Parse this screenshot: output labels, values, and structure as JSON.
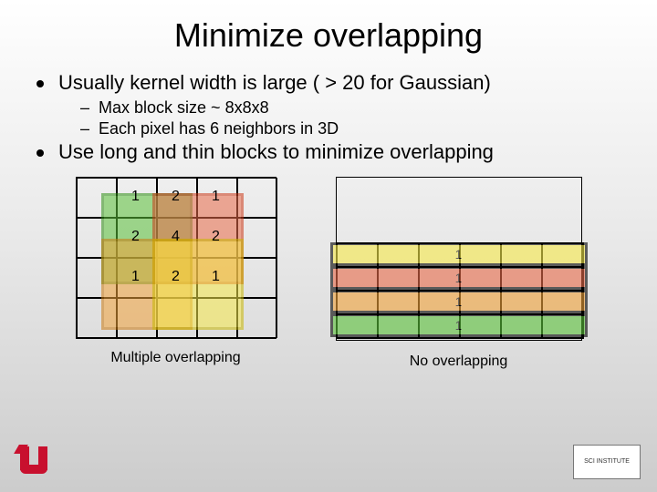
{
  "title": "Minimize overlapping",
  "bullets": [
    {
      "text": "Usually kernel width is large ( > 20 for Gaussian)"
    },
    {
      "text": "Use long and thin blocks to minimize overlapping"
    }
  ],
  "subbullets": [
    {
      "text": "Max block size ~ 8x8x8"
    },
    {
      "text": "Each pixel has 6 neighbors in 3D"
    }
  ],
  "left": {
    "caption": "Multiple overlapping",
    "values": {
      "r0c0": "1",
      "r0c1": "2",
      "r0c2": "1",
      "r1c0": "2",
      "r1c1": "4",
      "r1c2": "2",
      "r2c0": "1",
      "r2c1": "2",
      "r2c2": "1"
    }
  },
  "right": {
    "caption": "No overlapping",
    "row_values": [
      "1",
      "1",
      "1",
      "1"
    ]
  },
  "logos": {
    "sci": "SCI INSTITUTE"
  }
}
